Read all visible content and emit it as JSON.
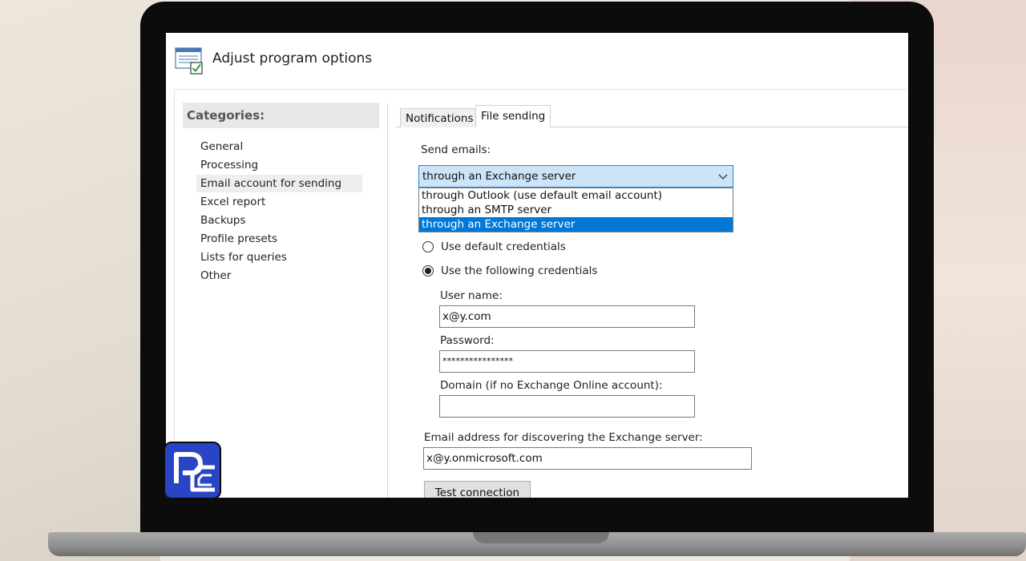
{
  "window": {
    "title": "Adjust program options"
  },
  "categories": {
    "header": "Categories:",
    "items": [
      {
        "label": "General"
      },
      {
        "label": "Processing"
      },
      {
        "label": "Email account for sending",
        "selected": true
      },
      {
        "label": "Excel report"
      },
      {
        "label": "Backups"
      },
      {
        "label": "Profile presets"
      },
      {
        "label": "Lists for queries"
      },
      {
        "label": "Other"
      }
    ]
  },
  "tabs": [
    {
      "label": "Notifications"
    },
    {
      "label": "File sending",
      "active": true
    }
  ],
  "send_emails": {
    "label": "Send emails:",
    "selected": "through an Exchange server",
    "options": [
      "through Outlook (use default email account)",
      "through an SMTP server",
      "through an Exchange server"
    ]
  },
  "credentials": {
    "default_label": "Use default credentials",
    "following_label": "Use the following credentials",
    "selected": "following"
  },
  "fields": {
    "username_label": "User name:",
    "username_value": "x@y.com",
    "password_label": "Password:",
    "password_value": "****************",
    "domain_label": "Domain (if no Exchange Online account):",
    "domain_value": ""
  },
  "discovery": {
    "label": "Email address for discovering the Exchange server:",
    "value": "x@y.onmicrosoft.com"
  },
  "buttons": {
    "test_connection": "Test connection"
  },
  "colors": {
    "selection_blue": "#0078d7",
    "select_fill": "#cce4f7",
    "select_border": "#2f7fd0",
    "logo_blue": "#2944c4"
  }
}
